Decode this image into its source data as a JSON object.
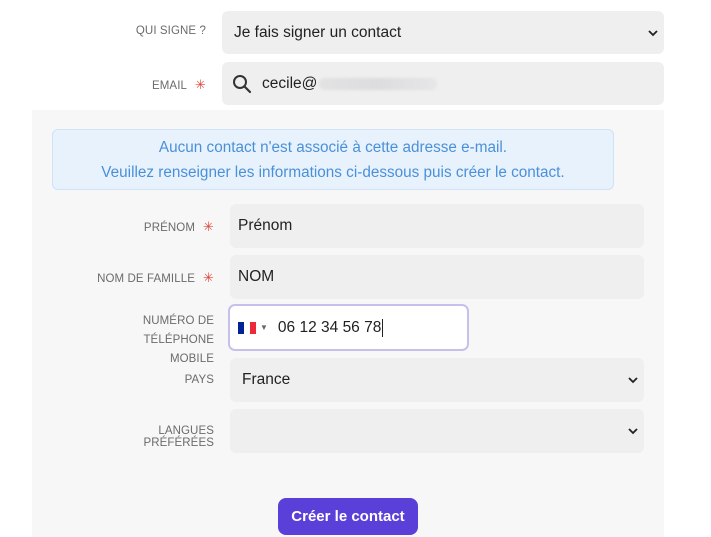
{
  "signer": {
    "label": "QUI SIGNE ?",
    "value": "Je fais signer un contact"
  },
  "email": {
    "label": "EMAIL",
    "required_mark": "✳",
    "value": "cecile@"
  },
  "notice": {
    "line1": "Aucun contact n'est associé à cette adresse e-mail.",
    "line2": "Veuillez renseigner les informations ci-dessous puis créer le contact."
  },
  "form": {
    "first_name": {
      "label": "PRÉNOM",
      "required_mark": "✳",
      "value": "Prénom"
    },
    "last_name": {
      "label": "NOM DE FAMILLE",
      "required_mark": "✳",
      "value": "NOM"
    },
    "phone": {
      "label_line1": "NUMÉRO DE TÉLÉPHONE",
      "label_line2": "MOBILE",
      "country_flag": "flag-france-icon",
      "value": "06 12 34 56 78"
    },
    "country": {
      "label": "PAYS",
      "value": "France"
    },
    "languages": {
      "label": "LANGUES PRÉFÉRÉES",
      "value": ""
    }
  },
  "actions": {
    "create_label": "Créer le contact"
  },
  "colors": {
    "accent": "#5b3fd9",
    "required": "#e0453a",
    "notice_text": "#4a90d9",
    "notice_bg": "#e8f2fd",
    "flag_blue": "#002395",
    "flag_red": "#ed2939"
  }
}
